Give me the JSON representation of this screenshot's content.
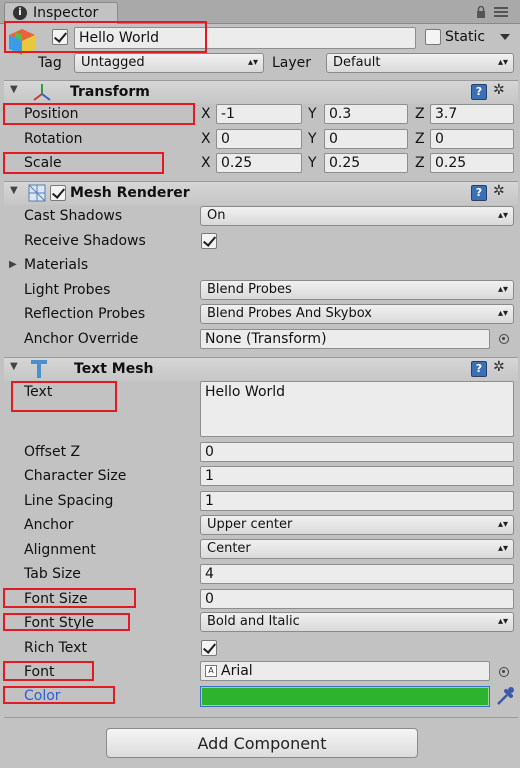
{
  "tab": {
    "label": "Inspector"
  },
  "object": {
    "name": "Hello World",
    "static_label": "Static",
    "tag_label": "Tag",
    "tag_value": "Untagged",
    "layer_label": "Layer",
    "layer_value": "Default"
  },
  "transform": {
    "title": "Transform",
    "position": {
      "label": "Position",
      "x": "-1",
      "y": "0.3",
      "z": "3.7"
    },
    "rotation": {
      "label": "Rotation",
      "x": "0",
      "y": "0",
      "z": "0"
    },
    "scale": {
      "label": "Scale",
      "x": "0.25",
      "y": "0.25",
      "z": "0.25"
    },
    "axis": {
      "x": "X",
      "y": "Y",
      "z": "Z"
    }
  },
  "mesh_renderer": {
    "title": "Mesh Renderer",
    "cast_shadows": {
      "label": "Cast Shadows",
      "value": "On"
    },
    "receive_shadows": {
      "label": "Receive Shadows",
      "checked": true
    },
    "materials": {
      "label": "Materials"
    },
    "light_probes": {
      "label": "Light Probes",
      "value": "Blend Probes"
    },
    "reflection_probes": {
      "label": "Reflection Probes",
      "value": "Blend Probes And Skybox"
    },
    "anchor_override": {
      "label": "Anchor Override",
      "value": "None (Transform)"
    }
  },
  "text_mesh": {
    "title": "Text Mesh",
    "text": {
      "label": "Text",
      "value": "Hello World"
    },
    "offset_z": {
      "label": "Offset Z",
      "value": "0"
    },
    "character_size": {
      "label": "Character Size",
      "value": "1"
    },
    "line_spacing": {
      "label": "Line Spacing",
      "value": "1"
    },
    "anchor": {
      "label": "Anchor",
      "value": "Upper center"
    },
    "alignment": {
      "label": "Alignment",
      "value": "Center"
    },
    "tab_size": {
      "label": "Tab Size",
      "value": "4"
    },
    "font_size": {
      "label": "Font Size",
      "value": "0"
    },
    "font_style": {
      "label": "Font Style",
      "value": "Bold and Italic"
    },
    "rich_text": {
      "label": "Rich Text",
      "checked": true
    },
    "font": {
      "label": "Font",
      "value": "Arial"
    },
    "color": {
      "label": "Color",
      "value": "#2db32d"
    }
  },
  "add_component": {
    "label": "Add Component"
  },
  "colors": {
    "highlight": "#e01b24",
    "link": "#2a5fd6",
    "swatch": "#2db32d"
  },
  "icons": [
    "info-icon",
    "lock-icon",
    "menu-icon",
    "cube-icon",
    "transform-icon",
    "mesh-renderer-icon",
    "text-mesh-icon",
    "help-icon",
    "gear-icon",
    "object-picker-icon",
    "eyedropper-icon",
    "font-icon"
  ]
}
